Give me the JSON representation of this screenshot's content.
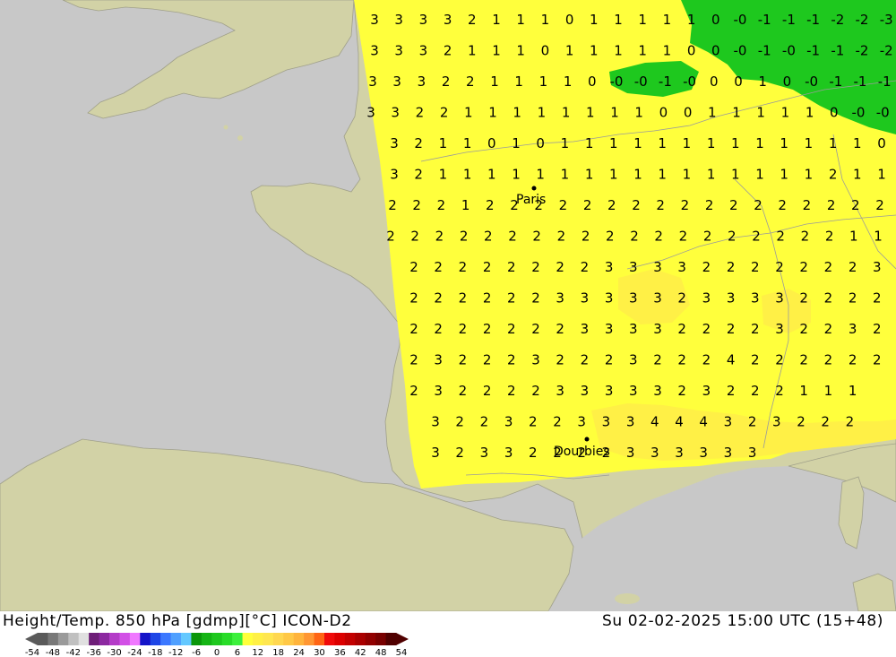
{
  "header": {
    "title": "Height/Temp. 850 hPa [gdmp][°C] ICON-D2",
    "datetime": "Su 02-02-2025 15:00 UTC (15+48)"
  },
  "legend": {
    "ticks": [
      "-54",
      "-48",
      "-42",
      "-36",
      "-30",
      "-24",
      "-18",
      "-12",
      "-6",
      "0",
      "6",
      "12",
      "18",
      "24",
      "30",
      "36",
      "42",
      "48",
      "54"
    ],
    "colors": [
      "#5a5a5a",
      "#787878",
      "#9a9a9a",
      "#c0c0c0",
      "#e0e0e0",
      "#6e1e78",
      "#8c28a0",
      "#b43cc8",
      "#d250e6",
      "#f078ff",
      "#1414c8",
      "#1e46e6",
      "#3c78ff",
      "#50a0ff",
      "#64c8ff",
      "#0a960a",
      "#14b414",
      "#1ec81e",
      "#28dc28",
      "#3cf03c",
      "#ffff3c",
      "#fff046",
      "#ffe650",
      "#ffd750",
      "#ffc846",
      "#ffb43c",
      "#ff9632",
      "#ff6414",
      "#f00a0a",
      "#dc0000",
      "#c30000",
      "#aa0000",
      "#910000",
      "#780000",
      "#500000"
    ]
  },
  "cities": [
    {
      "name": "Paris"
    },
    {
      "name": "Dourbies"
    }
  ],
  "grid_rows": [
    [
      "3",
      "3",
      "3",
      "3",
      "2",
      "1",
      "1",
      "1",
      "0",
      "1",
      "1",
      "1",
      "1",
      "1",
      "0",
      "-0",
      "-1",
      "-1",
      "-1",
      "-2",
      "-2",
      "-3"
    ],
    [
      "3",
      "3",
      "3",
      "2",
      "1",
      "1",
      "1",
      "0",
      "1",
      "1",
      "1",
      "1",
      "1",
      "0",
      "0",
      "-0",
      "-1",
      "-0",
      "-1",
      "-1",
      "-2",
      "-2",
      "-3"
    ],
    [
      "3",
      "3",
      "3",
      "2",
      "2",
      "1",
      "1",
      "1",
      "1",
      "0",
      "-0",
      "-0",
      "-1",
      "-0",
      "0",
      "0",
      "1",
      "0",
      "-0",
      "-1",
      "-1",
      "-1",
      "-2"
    ],
    [
      "3",
      "3",
      "2",
      "2",
      "1",
      "1",
      "1",
      "1",
      "1",
      "1",
      "1",
      "1",
      "0",
      "0",
      "1",
      "1",
      "1",
      "1",
      "1",
      "0",
      "-0",
      "-0",
      "-1",
      "-1"
    ],
    [
      "3",
      "2",
      "1",
      "1",
      "0",
      "1",
      "0",
      "1",
      "1",
      "1",
      "1",
      "1",
      "1",
      "1",
      "1",
      "1",
      "1",
      "1",
      "1",
      "1",
      "0",
      "0",
      "-0",
      "-0"
    ],
    [
      "3",
      "2",
      "1",
      "1",
      "1",
      "1",
      "1",
      "1",
      "1",
      "1",
      "1",
      "1",
      "1",
      "1",
      "1",
      "1",
      "1",
      "1",
      "2",
      "1",
      "1",
      "1",
      "1",
      "0"
    ],
    [
      "2",
      "2",
      "2",
      "1",
      "2",
      "2",
      "2",
      "2",
      "2",
      "2",
      "2",
      "2",
      "2",
      "2",
      "2",
      "2",
      "2",
      "2",
      "2",
      "2",
      "2",
      "1",
      "1"
    ],
    [
      "2",
      "2",
      "2",
      "2",
      "2",
      "2",
      "2",
      "2",
      "2",
      "2",
      "2",
      "2",
      "2",
      "2",
      "2",
      "2",
      "2",
      "2",
      "2",
      "1",
      "1",
      "1"
    ],
    [
      "2",
      "2",
      "2",
      "2",
      "2",
      "2",
      "2",
      "2",
      "3",
      "3",
      "3",
      "3",
      "2",
      "2",
      "2",
      "2",
      "2",
      "2",
      "2",
      "3"
    ],
    [
      "2",
      "2",
      "2",
      "2",
      "2",
      "2",
      "3",
      "3",
      "3",
      "3",
      "3",
      "2",
      "3",
      "3",
      "3",
      "3",
      "2",
      "2",
      "2",
      "2"
    ],
    [
      "2",
      "2",
      "2",
      "2",
      "2",
      "2",
      "2",
      "3",
      "3",
      "3",
      "3",
      "2",
      "2",
      "2",
      "2",
      "3",
      "2",
      "2",
      "3",
      "2"
    ],
    [
      "2",
      "3",
      "2",
      "2",
      "2",
      "3",
      "2",
      "2",
      "2",
      "3",
      "2",
      "2",
      "2",
      "4",
      "2",
      "2",
      "2",
      "2",
      "2",
      "2"
    ],
    [
      "2",
      "3",
      "2",
      "2",
      "2",
      "2",
      "3",
      "3",
      "3",
      "3",
      "3",
      "2",
      "3",
      "2",
      "2",
      "2",
      "1",
      "1",
      "1"
    ],
    [
      "3",
      "2",
      "2",
      "3",
      "2",
      "2",
      "3",
      "3",
      "3",
      "4",
      "4",
      "4",
      "3",
      "2",
      "3",
      "2",
      "2",
      "2"
    ],
    [
      "3",
      "2",
      "3",
      "3",
      "2",
      "2",
      "2",
      "2",
      "3",
      "3",
      "3",
      "3",
      "3",
      "3"
    ]
  ]
}
